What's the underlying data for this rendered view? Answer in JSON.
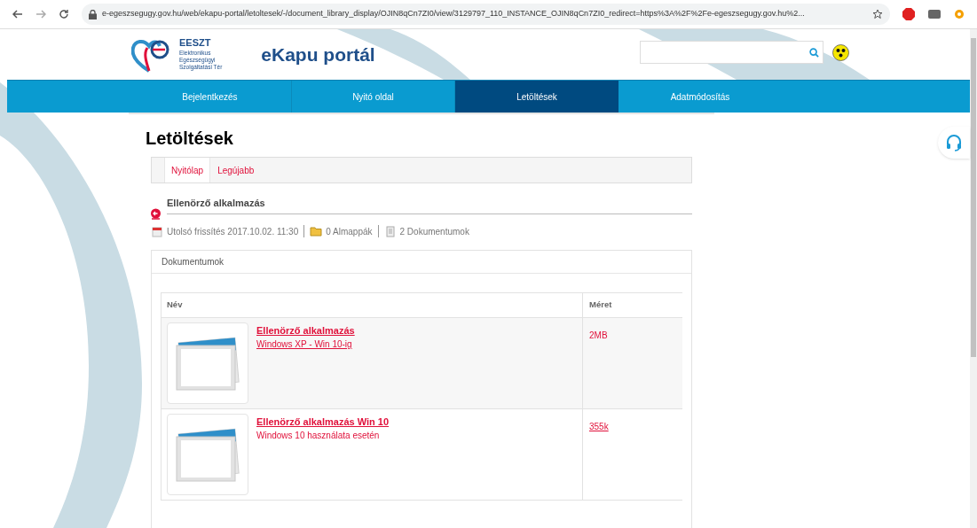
{
  "browser": {
    "url": "e-egeszsegugy.gov.hu/web/ekapu-portal/letoltesek/-/document_library_display/OJIN8qCn7ZI0/view/3129797_110_INSTANCE_OJIN8qCn7ZI0_redirect=https%3A%2F%2Fe-egeszsegugy.gov.hu%2..."
  },
  "header": {
    "logo_acronym": "EESZT",
    "logo_lines": [
      "Elektronikus",
      "Egészségügyi",
      "Szolgáltatási Tér"
    ],
    "site_title": "eKapu portál"
  },
  "nav": [
    {
      "label": "Bejelentkezés",
      "selected": false
    },
    {
      "label": "Nyitó oldal",
      "selected": false
    },
    {
      "label": "Letöltések",
      "selected": true
    },
    {
      "label": "Adatmódosítás",
      "selected": false
    }
  ],
  "page_title": "Letöltések",
  "tabs": [
    {
      "label": "Nyitólap",
      "selected": true
    },
    {
      "label": "Legújabb",
      "selected": false
    }
  ],
  "folder": {
    "title": "Ellenörző alkalmazás",
    "last_updated": "Utolsó frissítés 2017.10.02. 11:30",
    "subfolders": "0 Almappák",
    "documents": "2 Dokumentumok"
  },
  "panel": {
    "title": "Dokumentumok",
    "columns": [
      "Név",
      "Méret"
    ],
    "rows": [
      {
        "title": "Ellenörző alkalmazás",
        "description": "Windows XP - Win 10-ig",
        "size": "2MB",
        "highlighted": true
      },
      {
        "title": "Ellenörző alkalmazás Win 10",
        "description": "Windows 10 használata esetén",
        "size": "355k",
        "highlighted": false
      }
    ]
  }
}
